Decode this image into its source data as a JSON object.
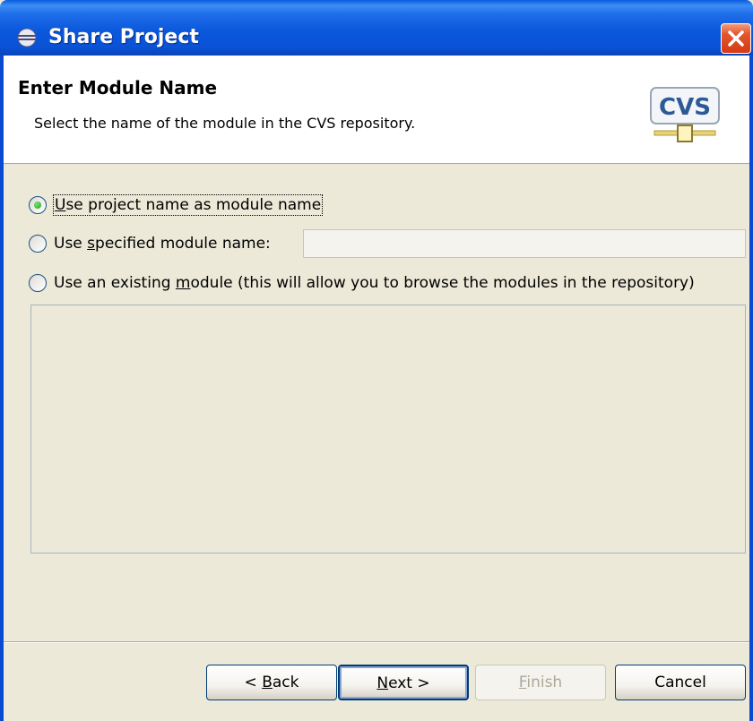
{
  "window": {
    "title": "Share Project"
  },
  "header": {
    "title": "Enter Module Name",
    "description": "Select the name of the module in the CVS repository.",
    "logo_text": "CVS"
  },
  "options": {
    "use_project_name": {
      "pre": "",
      "key": "U",
      "post": "se project name as module name",
      "selected": true
    },
    "use_specified": {
      "pre": "Use ",
      "key": "s",
      "post": "pecified module name:",
      "selected": false
    },
    "use_existing": {
      "pre": "Use an existing ",
      "key": "m",
      "post": "odule (this will allow you to browse the modules in the repository)",
      "selected": false
    }
  },
  "module_name_input": {
    "value": ""
  },
  "buttons": {
    "back": {
      "pre": "< ",
      "key": "B",
      "post": "ack"
    },
    "next": {
      "pre": "",
      "key": "N",
      "post": "ext >"
    },
    "finish": {
      "pre": "",
      "key": "F",
      "post": "inish"
    },
    "cancel": {
      "label": "Cancel"
    }
  },
  "colors": {
    "titlebar": "#0a5ce0",
    "dialog_bg": "#ece9d8",
    "close": "#d43a14",
    "radio_dot": "#21a121"
  }
}
